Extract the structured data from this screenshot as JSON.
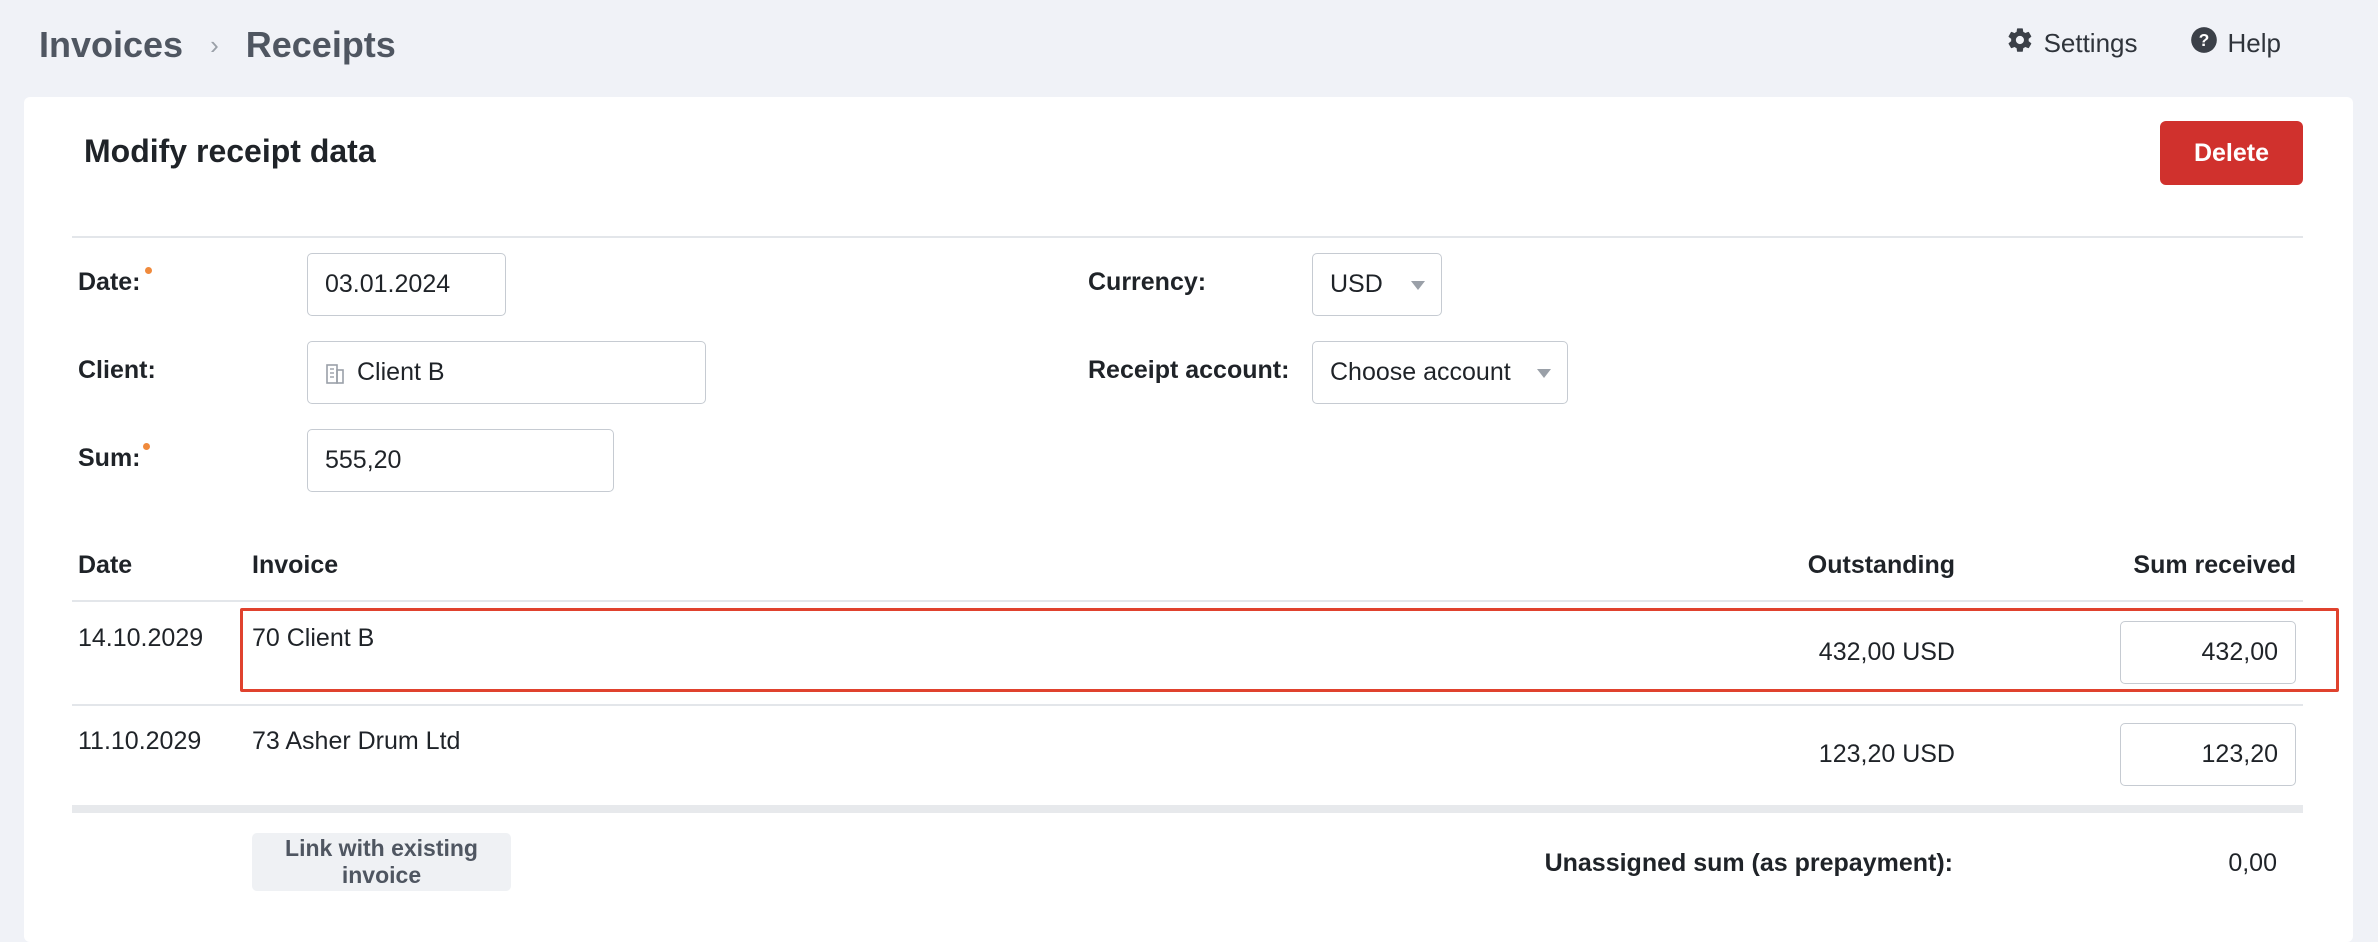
{
  "breadcrumb": {
    "items": [
      "Invoices",
      "Receipts"
    ],
    "separator": "›"
  },
  "top_actions": {
    "settings": "Settings",
    "help": "Help"
  },
  "card": {
    "title": "Modify receipt data",
    "delete_label": "Delete"
  },
  "form": {
    "date": {
      "label": "Date:",
      "value": "03.01.2024",
      "required": true
    },
    "client": {
      "label": "Client:",
      "value": "Client B"
    },
    "sum": {
      "label": "Sum:",
      "value": "555,20",
      "required": true
    },
    "currency": {
      "label": "Currency:",
      "value": "USD"
    },
    "receipt_account": {
      "label": "Receipt account:",
      "value": "Choose account"
    }
  },
  "table": {
    "headers": {
      "date": "Date",
      "invoice": "Invoice",
      "outstanding": "Outstanding",
      "sum_received": "Sum received"
    },
    "rows": [
      {
        "date": "14.10.2029",
        "invoice": "70 Client B",
        "outstanding": "432,00 USD",
        "sum_received": "432,00"
      },
      {
        "date": "11.10.2029",
        "invoice": "73 Asher Drum Ltd",
        "outstanding": "123,20 USD",
        "sum_received": "123,20"
      }
    ]
  },
  "footer": {
    "link_button": "Link with existing invoice",
    "unassigned_label": "Unassigned sum (as prepayment):",
    "unassigned_value": "0,00"
  },
  "colors": {
    "accent_delete": "#d0312d",
    "highlight": "#e0422e",
    "required_dot": "#f08a3c"
  }
}
